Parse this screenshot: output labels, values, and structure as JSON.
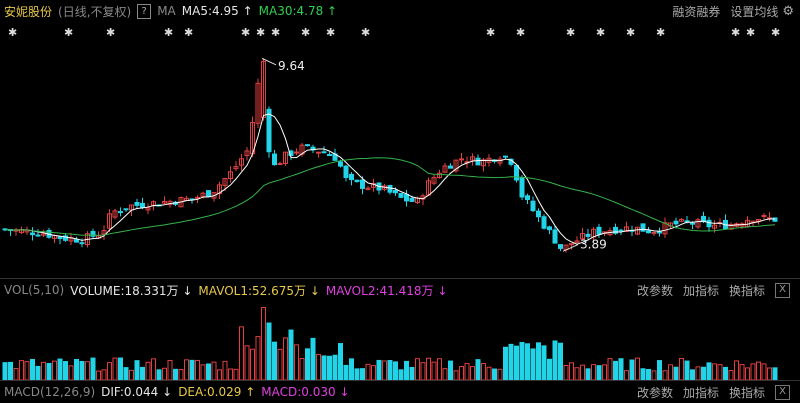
{
  "header": {
    "stock_name": "安妮股份",
    "period": "(日线,不复权)",
    "question_label": "?",
    "ma_label": "MA",
    "ma5": "MA5:4.95",
    "ma5_arrow": "↑",
    "ma30": "MA30:4.78",
    "ma30_arrow": "↑",
    "tool_margin": "融资融券",
    "tool_setting": "设置均线"
  },
  "price_chart": {
    "high_label": "9.64",
    "low_label": "3.89",
    "ymin": 3.4,
    "ymax": 10.3,
    "up_color": "#e04040",
    "down_color": "#22d4e8",
    "ma5_color": "#ffffff",
    "ma30_color": "#34b34a",
    "marker_color": "#dddddd"
  },
  "volume_panel": {
    "label": "VOL(5,10)",
    "volume": "VOLUME:18.331万",
    "volume_arrow": "↓",
    "mavol1": "MAVOL1:52.675万",
    "mavol1_arrow": "↓",
    "mavol2": "MAVOL2:41.418万",
    "mavol2_arrow": "↓",
    "tool_params": "改参数",
    "tool_add": "加指标",
    "tool_switch": "换指标",
    "close": "X"
  },
  "macd_panel": {
    "label": "MACD(12,26,9)",
    "dif": "DIF:0.044",
    "dif_arrow": "↓",
    "dea": "DEA:0.029",
    "dea_arrow": "↑",
    "macd": "MACD:0.030",
    "macd_arrow": "↓",
    "tool_params": "改参数",
    "tool_add": "加指标",
    "tool_switch": "换指标",
    "close": "X"
  }
}
